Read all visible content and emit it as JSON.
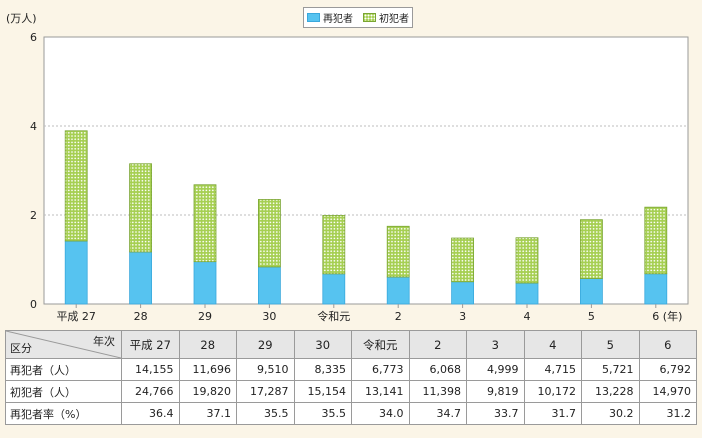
{
  "chart_data": {
    "type": "bar",
    "stacked": true,
    "unit_label": "(万人)",
    "x_suffix": "(年)",
    "categories": [
      "平成 27",
      "28",
      "29",
      "30",
      "令和元",
      "2",
      "3",
      "4",
      "5",
      "6"
    ],
    "series": [
      {
        "name": "再犯者",
        "values": [
          1.4155,
          1.1696,
          0.951,
          0.8335,
          0.6773,
          0.6068,
          0.4999,
          0.4715,
          0.5721,
          0.6792
        ],
        "color": "#56c3f0"
      },
      {
        "name": "初犯者",
        "values": [
          2.4766,
          1.982,
          1.7287,
          1.5154,
          1.3141,
          1.1398,
          0.9819,
          1.0172,
          1.3228,
          1.497
        ],
        "color": "#a6cf52"
      }
    ],
    "ylim": [
      0,
      6
    ],
    "yticks": [
      "0",
      "2",
      "4",
      "6"
    ],
    "grid": true,
    "legend_position": "top-center"
  },
  "table": {
    "corner_top": "年次",
    "corner_bottom": "区分",
    "headers": [
      "平成 27",
      "28",
      "29",
      "30",
      "令和元",
      "2",
      "3",
      "4",
      "5",
      "6"
    ],
    "rows": [
      {
        "label": "再犯者（人）",
        "values": [
          "14,155",
          "11,696",
          "9,510",
          "8,335",
          "6,773",
          "6,068",
          "4,999",
          "4,715",
          "5,721",
          "6,792"
        ]
      },
      {
        "label": "初犯者（人）",
        "values": [
          "24,766",
          "19,820",
          "17,287",
          "15,154",
          "13,141",
          "11,398",
          "9,819",
          "10,172",
          "13,228",
          "14,970"
        ]
      },
      {
        "label": "再犯者率（%）",
        "values": [
          "36.4",
          "37.1",
          "35.5",
          "35.5",
          "34.0",
          "34.7",
          "33.7",
          "31.7",
          "30.2",
          "31.2"
        ]
      }
    ]
  }
}
